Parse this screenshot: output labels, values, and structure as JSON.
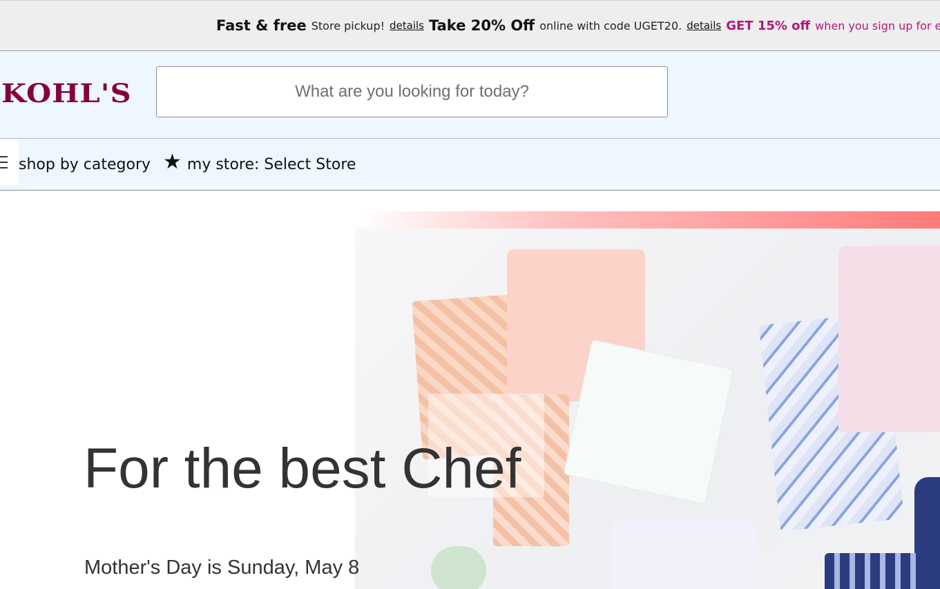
{
  "promo": {
    "part1_strong": "Fast & free",
    "part1_text": "Store pickup!",
    "part1_link": "details",
    "part2_strong": "Take 20% Off",
    "part2_text": "online with code UGET20.",
    "part2_link": "details",
    "part3_strong": "GET 15% off",
    "part3_text": "when you sign up for e"
  },
  "header": {
    "logo": "KOHL'S",
    "search_placeholder": "What are you looking for today?"
  },
  "nav": {
    "category_label": "shop by category",
    "store_label": "my store: Select Store"
  },
  "hero": {
    "title": "For the best Chef",
    "subtitle": "Mother's Day is Sunday, May 8"
  },
  "colors": {
    "brand": "#85003f",
    "promo_accent": "#b0187a",
    "header_bg": "#eef6ff",
    "promo_bg": "#eeeeee"
  },
  "icons": {
    "menu": "hamburger-menu-icon",
    "store": "star-icon"
  }
}
